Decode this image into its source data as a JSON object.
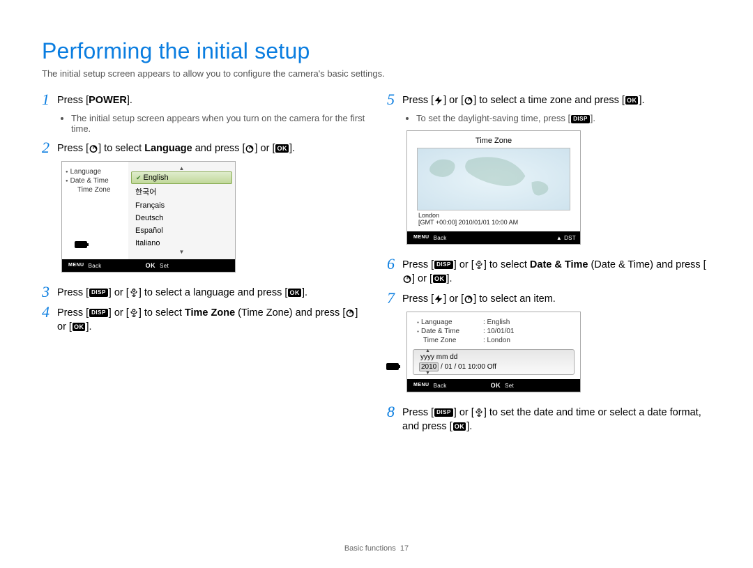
{
  "title": "Performing the initial setup",
  "intro": "The initial setup screen appears to allow you to configure the camera's basic settings.",
  "footer": {
    "section": "Basic functions",
    "page": "17"
  },
  "icons": {
    "disp": "DISP",
    "ok": "OK",
    "menu": "MENU"
  },
  "steps": {
    "s1": {
      "pre": "Press [",
      "kw": "POWER",
      "post": "].",
      "bullet": "The initial setup screen appears when you turn on the camera for the first time."
    },
    "s2": {
      "t1": "Press [",
      "t2": "] to select ",
      "kw": "Language",
      "t3": " and press [",
      "t4": "] or ["
    },
    "s3": {
      "t1": "Press [",
      "t2": "] or [",
      "t3": "] to select a language and press ["
    },
    "s4": {
      "t1": "Press [",
      "t2": "] or [",
      "t3": "] to select ",
      "kw": "Time Zone",
      "paren": " (Time Zone) and press [",
      "t4": "] or ["
    },
    "s5": {
      "t1": "Press [",
      "t2": "] or [",
      "t3": "] to select a time zone and press [",
      "bullet_pre": "To set the daylight-saving time, press [",
      "bullet_post": "]."
    },
    "s6": {
      "t1": "Press [",
      "t2": "] or [",
      "t3": "] to select ",
      "kw": "Date & Time",
      "paren": " (Date & Time) and press [",
      "t4": "] or ["
    },
    "s7": {
      "t1": "Press [",
      "t2": "] or [",
      "t3": "] to select an item."
    },
    "s8": {
      "t1": "Press [",
      "t2": "] or [",
      "t3": "] to set the date and time or select a date format, and press ["
    }
  },
  "shot1": {
    "left": {
      "language": "Language",
      "datetime": "Date & Time",
      "timezone": "Time Zone"
    },
    "langs": [
      "English",
      "한국어",
      "Français",
      "Deutsch",
      "Español",
      "Italiano"
    ],
    "footer": {
      "back": "Back",
      "set": "Set"
    }
  },
  "shot2": {
    "title": "Time Zone",
    "city": "London",
    "gmt": "[GMT +00:00]  2010/01/01  10:00 AM",
    "footer": {
      "back": "Back",
      "dst": "DST"
    }
  },
  "shot3": {
    "rows": {
      "language": {
        "k": "Language",
        "v": ": English"
      },
      "datetime": {
        "k": "Date & Time",
        "v": ": 10/01/01"
      },
      "timezone": {
        "k": "Time Zone",
        "v": ": London"
      }
    },
    "panel": {
      "head": "yyyy  mm   dd",
      "y": "2010",
      "rest": "/ 01 / 01   10:00    Off"
    },
    "footer": {
      "back": "Back",
      "set": "Set"
    }
  }
}
